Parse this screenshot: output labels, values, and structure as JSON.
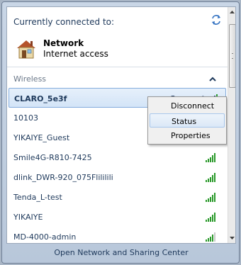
{
  "header": {
    "title": "Currently connected to:",
    "refresh_icon": "refresh-arrows-icon"
  },
  "current": {
    "name": "Network",
    "status": "Internet access",
    "icon": "house-icon"
  },
  "section": {
    "label": "Wireless",
    "toggle_icon": "chevron-up-icon"
  },
  "networks": [
    {
      "name": "CLARO_5e3f",
      "state": "Connected",
      "selected": true
    },
    {
      "name": "10103"
    },
    {
      "name": "YIKAIYE_Guest"
    },
    {
      "name": "Smile4G-R810-7425"
    },
    {
      "name": "dlink_DWR-920_075Flililili"
    },
    {
      "name": "Tenda_L-test"
    },
    {
      "name": "YIKAIYE"
    },
    {
      "name": "MD-4000-admin"
    }
  ],
  "context_menu": {
    "items": [
      "Disconnect",
      "Status",
      "Properties"
    ],
    "highlighted": "Status"
  },
  "footer": {
    "link": "Open Network and Sharing Center"
  },
  "colors": {
    "accent": "#1e395b",
    "signal": "#2b9a2b",
    "selection": "#d3e4f7"
  }
}
